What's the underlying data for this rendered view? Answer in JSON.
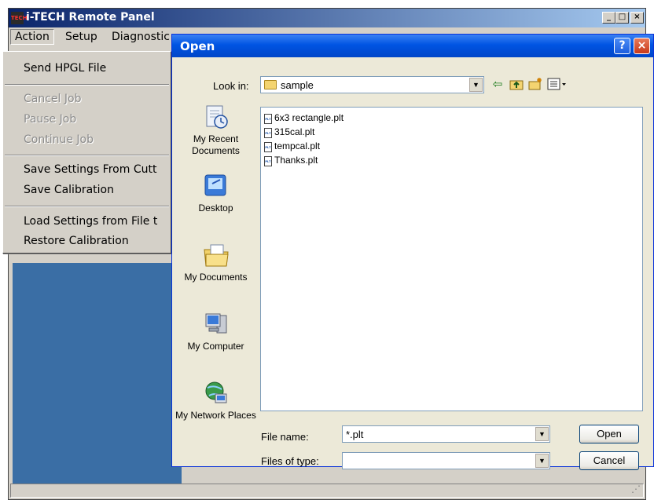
{
  "main_window": {
    "title": "i-TECH Remote Panel",
    "icon_text": "TECH",
    "caption_buttons": [
      "_",
      "□",
      "×"
    ],
    "menu": [
      "Action",
      "Setup",
      "Diagnostic"
    ],
    "dropdown": {
      "group1": [
        "Send HPGL File"
      ],
      "group2": [
        "Cancel Job",
        "Pause Job",
        "Continue Job"
      ],
      "group3": [
        "Save Settings From Cutt",
        "Save Calibration"
      ],
      "group4": [
        "Load Settings from File t",
        "Restore Calibration"
      ]
    }
  },
  "dialog": {
    "title": "Open",
    "help_label": "?",
    "close_label": "×",
    "look_in_label": "Look in:",
    "look_in_value": "sample",
    "places": [
      "My Recent Documents",
      "Desktop",
      "My Documents",
      "My Computer",
      "My Network Places"
    ],
    "files": [
      "6x3 rectangle.plt",
      "315cal.plt",
      "tempcal.plt",
      "Thanks.plt"
    ],
    "file_icon_text": "PLT",
    "file_name_label": "File name:",
    "file_name_value": "*.plt",
    "files_of_type_label": "Files of type:",
    "files_of_type_value": "",
    "open_button": "Open",
    "cancel_button": "Cancel"
  },
  "icons": {
    "back": "back-arrow-icon",
    "up": "up-folder-icon",
    "new_folder": "new-folder-icon",
    "views": "views-menu-icon"
  }
}
